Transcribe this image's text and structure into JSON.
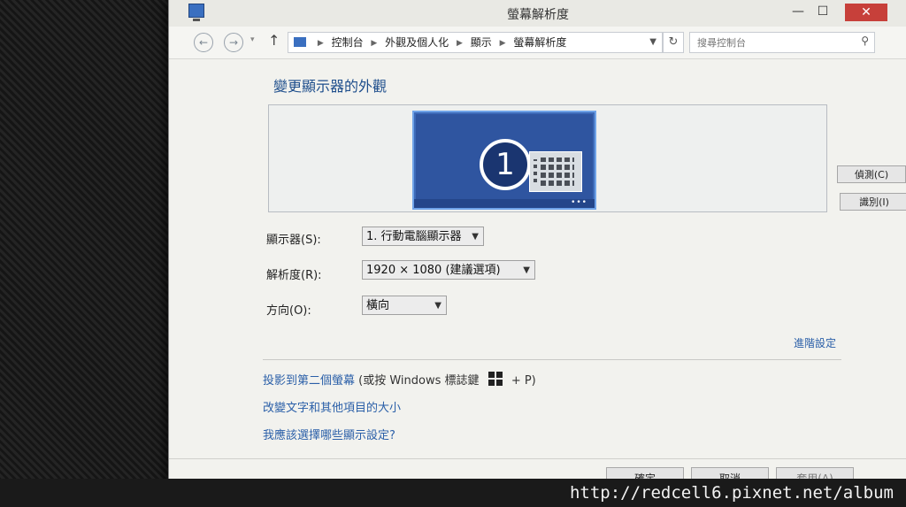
{
  "window": {
    "title": "螢幕解析度",
    "minimize_glyph": "—",
    "maximize_glyph": "☐",
    "close_glyph": "✕"
  },
  "address": {
    "breadcrumbs": [
      "控制台",
      "外觀及個人化",
      "顯示",
      "螢幕解析度"
    ],
    "search_placeholder": "搜尋控制台"
  },
  "main": {
    "heading": "變更顯示器的外觀",
    "monitor_number": "1",
    "detect_button": "偵測(C)",
    "identify_button": "識別(I)",
    "display_label": "顯示器(S):",
    "display_value": "1. 行動電腦顯示器",
    "resolution_label": "解析度(R):",
    "resolution_value": "1920 × 1080 (建議選項)",
    "orientation_label": "方向(O):",
    "orientation_value": "橫向",
    "advanced_link": "進階設定",
    "project_link": "投影到第二個螢幕",
    "project_hint_prefix": "(或按 Windows 標誌鍵",
    "project_hint_suffix": "+ P)",
    "text_size_link": "改變文字和其他項目的大小",
    "which_settings_link": "我應該選擇哪些顯示設定?"
  },
  "footer": {
    "ok_button": "確定",
    "cancel_button": "取消",
    "apply_button": "套用(A)"
  },
  "watermark": "http://redcell6.pixnet.net/album"
}
